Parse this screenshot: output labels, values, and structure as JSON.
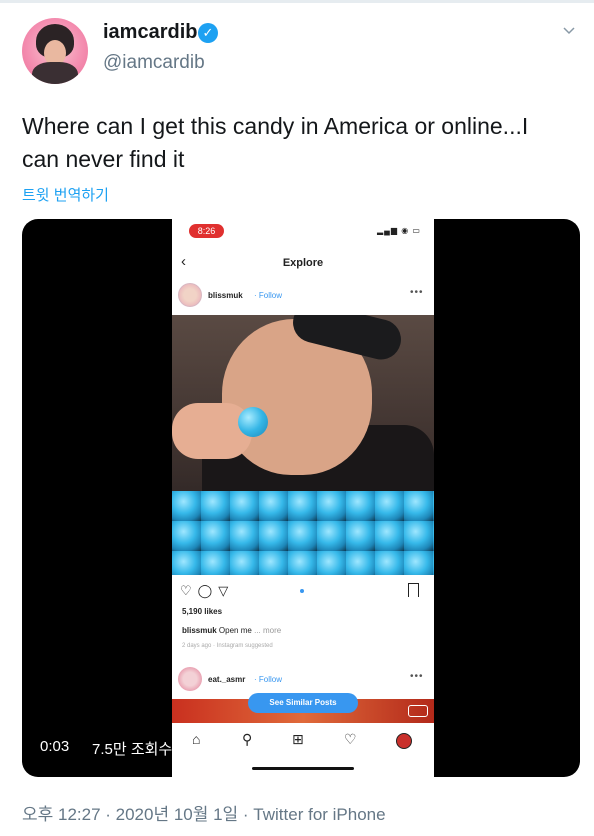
{
  "tweet": {
    "display_name": "iamcardib",
    "handle": "@iamcardib",
    "text": "Where can I get this candy in America or online...I can never find it",
    "translate_link": "트윗 번역하기",
    "timestamp": "오후 12:27 · 2020년 10월 1일 · Twitter for iPhone"
  },
  "video": {
    "elapsed": "0:03",
    "views": "7.5만 조회수"
  },
  "instagram": {
    "status_time": "8:26",
    "page_title": "Explore",
    "post": {
      "username": "blissmuk",
      "follow_label": "· Follow",
      "likes": "5,190 likes",
      "caption_user": "blissmuk",
      "caption_text": "Open me",
      "caption_more": "... more",
      "meta": "2 days ago · Instagram suggested"
    },
    "post2": {
      "username": "eat._asmr",
      "follow_label": "· Follow"
    },
    "similar_posts_label": "See Similar Posts"
  },
  "icons": {
    "verified": "verified-badge-icon",
    "menu": "chevron-down-icon"
  },
  "colors": {
    "twitter_blue": "#1da1f2",
    "instagram_blue": "#3897f0",
    "status_red": "#e0302f"
  }
}
